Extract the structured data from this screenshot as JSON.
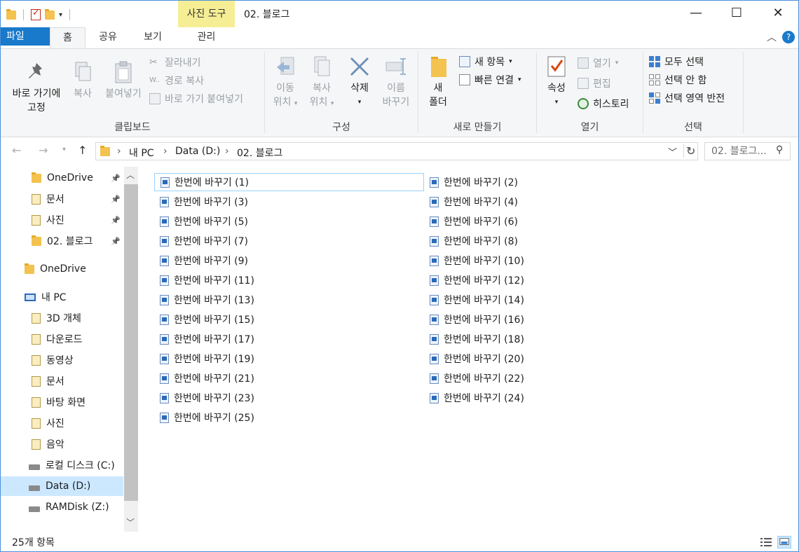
{
  "titlebar": {
    "title": "02. 블로그",
    "contextual_tab": "사진 도구",
    "minimize": "—",
    "maximize": "☐",
    "close": "✕"
  },
  "tabs": {
    "file": "파일",
    "home": "홈",
    "share": "공유",
    "view": "보기",
    "manage": "관리"
  },
  "ribbon": {
    "clipboard": {
      "label": "클립보드",
      "pin_line1": "바로 가기에",
      "pin_line2": "고정",
      "copy": "복사",
      "paste": "붙여넣기",
      "cut": "잘라내기",
      "copy_path": "경로 복사",
      "paste_shortcut": "바로 가기 붙여넣기"
    },
    "organize": {
      "label": "구성",
      "move_line1": "이동",
      "move_line2": "위치",
      "copyto_line1": "복사",
      "copyto_line2": "위치",
      "delete": "삭제",
      "rename_line1": "이름",
      "rename_line2": "바꾸기"
    },
    "new": {
      "label": "새로 만들기",
      "folder_line1": "새",
      "folder_line2": "폴더",
      "new_item": "새 항목",
      "easy_access": "빠른 연결"
    },
    "open": {
      "label": "열기",
      "properties": "속성",
      "open": "열기",
      "edit": "편집",
      "history": "히스토리"
    },
    "select": {
      "label": "선택",
      "select_all": "모두 선택",
      "select_none": "선택 안 함",
      "invert": "선택 영역 반전"
    }
  },
  "address": {
    "crumbs": [
      "내 PC",
      "Data (D:)",
      "02. 블로그"
    ],
    "search_placeholder": "02. 블로그..."
  },
  "navpane": {
    "items": [
      {
        "label": "OneDrive",
        "icon": "folder-icon",
        "pinned": true
      },
      {
        "label": "문서",
        "icon": "documents-icon",
        "pinned": true
      },
      {
        "label": "사진",
        "icon": "pictures-icon",
        "pinned": true
      },
      {
        "label": "02. 블로그",
        "icon": "folder-icon",
        "pinned": true
      },
      {
        "label": "OneDrive",
        "icon": "folder-icon",
        "pinned": false
      },
      {
        "label": "내 PC",
        "icon": "computer-icon",
        "pinned": false
      },
      {
        "label": "3D 개체",
        "icon": "3d-objects-icon",
        "pinned": false
      },
      {
        "label": "다운로드",
        "icon": "downloads-icon",
        "pinned": false
      },
      {
        "label": "동영상",
        "icon": "videos-icon",
        "pinned": false
      },
      {
        "label": "문서",
        "icon": "documents-icon",
        "pinned": false
      },
      {
        "label": "바탕 화면",
        "icon": "desktop-icon",
        "pinned": false
      },
      {
        "label": "사진",
        "icon": "pictures-icon",
        "pinned": false
      },
      {
        "label": "음악",
        "icon": "music-icon",
        "pinned": false
      },
      {
        "label": "로컬 디스크 (C:)",
        "icon": "windows-drive-icon",
        "pinned": false
      },
      {
        "label": "Data (D:)",
        "icon": "drive-icon",
        "pinned": false,
        "selected": true
      },
      {
        "label": "RAMDisk (Z:)",
        "icon": "drive-icon",
        "pinned": false
      }
    ]
  },
  "files": [
    "한번에 바꾸기 (1)",
    "한번에 바꾸기 (2)",
    "한번에 바꾸기 (3)",
    "한번에 바꾸기 (4)",
    "한번에 바꾸기 (5)",
    "한번에 바꾸기 (6)",
    "한번에 바꾸기 (7)",
    "한번에 바꾸기 (8)",
    "한번에 바꾸기 (9)",
    "한번에 바꾸기 (10)",
    "한번에 바꾸기 (11)",
    "한번에 바꾸기 (12)",
    "한번에 바꾸기 (13)",
    "한번에 바꾸기 (14)",
    "한번에 바꾸기 (15)",
    "한번에 바꾸기 (16)",
    "한번에 바꾸기 (17)",
    "한번에 바꾸기 (18)",
    "한번에 바꾸기 (19)",
    "한번에 바꾸기 (20)",
    "한번에 바꾸기 (21)",
    "한번에 바꾸기 (22)",
    "한번에 바꾸기 (23)",
    "한번에 바꾸기 (24)",
    "한번에 바꾸기 (25)"
  ],
  "status": {
    "count": "25개 항목"
  },
  "colors": {
    "accent": "#1979ca",
    "contextual": "#f6ee95",
    "selection": "#cce8ff",
    "folder": "#f3c24f"
  }
}
